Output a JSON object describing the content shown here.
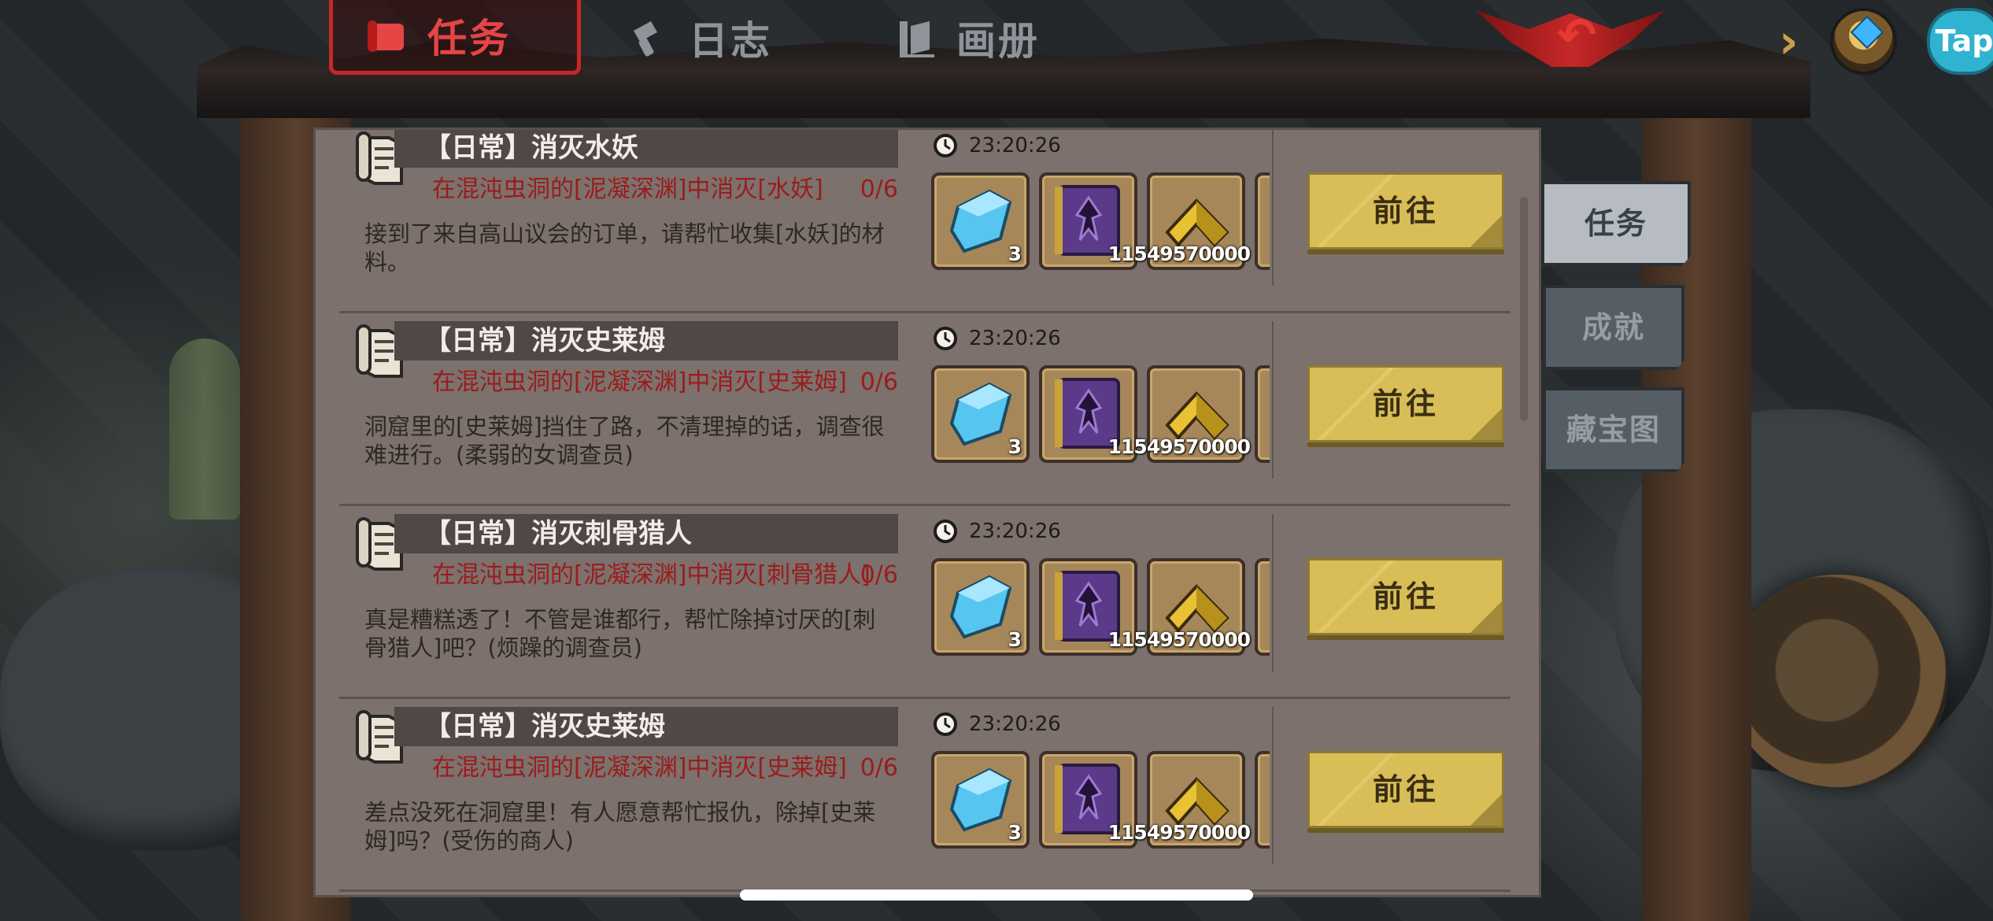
{
  "header": {
    "tabs": [
      {
        "label": "任务",
        "active": true
      },
      {
        "label": "日志",
        "active": false
      },
      {
        "label": "画册",
        "active": false
      }
    ],
    "taptap_label": "Tap"
  },
  "side_tabs": [
    {
      "label": "任务",
      "active": true
    },
    {
      "label": "成就",
      "active": false
    },
    {
      "label": "藏宝图",
      "active": false
    }
  ],
  "quests": [
    {
      "title": "【日常】消灭水妖",
      "objective": "在混沌虫洞的[泥凝深渊]中消灭[水妖]",
      "progress": "0/6",
      "description": "接到了来自高山议会的订单，请帮忙收集[水妖]的材料。",
      "timer": "23:20:26",
      "rewards": [
        {
          "icon": "blue-crystal-icon",
          "count": "3"
        },
        {
          "icon": "purple-spellbook-icon",
          "count": ""
        },
        {
          "icon": "gold-chevron-icon",
          "count": "11549570000"
        }
      ],
      "button": "前往"
    },
    {
      "title": "【日常】消灭史莱姆",
      "objective": "在混沌虫洞的[泥凝深渊]中消灭[史莱姆]",
      "progress": "0/6",
      "description": "洞窟里的[史莱姆]挡住了路，不清理掉的话，调查很难进行。(柔弱的女调查员)",
      "timer": "23:20:26",
      "rewards": [
        {
          "icon": "blue-crystal-icon",
          "count": "3"
        },
        {
          "icon": "purple-spellbook-icon",
          "count": ""
        },
        {
          "icon": "gold-chevron-icon",
          "count": "11549570000"
        }
      ],
      "button": "前往"
    },
    {
      "title": "【日常】消灭刺骨猎人",
      "objective": "在混沌虫洞的[泥凝深渊]中消灭[刺骨猎人]",
      "progress": "0/6",
      "description": "真是糟糕透了！不管是谁都行，帮忙除掉讨厌的[刺骨猎人]吧？(烦躁的调查员)",
      "timer": "23:20:26",
      "rewards": [
        {
          "icon": "blue-crystal-icon",
          "count": "3"
        },
        {
          "icon": "purple-spellbook-icon",
          "count": ""
        },
        {
          "icon": "gold-chevron-icon",
          "count": "11549570000"
        }
      ],
      "button": "前往"
    },
    {
      "title": "【日常】消灭史莱姆",
      "objective": "在混沌虫洞的[泥凝深渊]中消灭[史莱姆]",
      "progress": "0/6",
      "description": "差点没死在洞窟里！有人愿意帮忙报仇，除掉[史莱姆]吗？(受伤的商人)",
      "timer": "23:20:26",
      "rewards": [
        {
          "icon": "blue-crystal-icon",
          "count": "3"
        },
        {
          "icon": "purple-spellbook-icon",
          "count": ""
        },
        {
          "icon": "gold-chevron-icon",
          "count": "11549570000"
        }
      ],
      "button": "前往"
    }
  ],
  "colors": {
    "accent_red": "#e64545",
    "objective_red": "#9a1c1c",
    "button_gold": "#d9bd57",
    "panel": "#7c716c"
  }
}
